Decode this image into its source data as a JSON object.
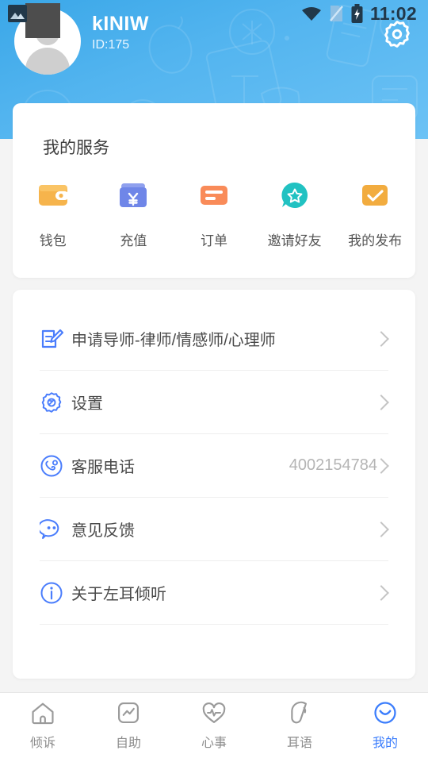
{
  "status_bar": {
    "time": "11:02",
    "icons": [
      "gallery-icon",
      "wifi-icon",
      "no-sim-icon",
      "battery-charging-icon"
    ]
  },
  "header": {
    "username": "kINIW",
    "user_id": "ID:175",
    "avatar_icon": "default-avatar-icon",
    "settings_icon": "gear-icon",
    "bg_color": "#52b4ef"
  },
  "service_card": {
    "title": "我的服务",
    "items": [
      {
        "label": "钱包",
        "icon": "wallet-icon",
        "color": "#f6b44c"
      },
      {
        "label": "充值",
        "icon": "recharge-card-icon",
        "color": "#6f86e8"
      },
      {
        "label": "订单",
        "icon": "order-list-icon",
        "color": "#f98b59"
      },
      {
        "label": "邀请好友",
        "icon": "invite-star-icon",
        "color": "#21c2c2"
      },
      {
        "label": "我的发布",
        "icon": "check-square-icon",
        "color": "#f2ac3f"
      }
    ]
  },
  "menu_card": {
    "rows": [
      {
        "label": "申请导师-律师/情感师/心理师",
        "icon": "apply-edit-icon",
        "value": ""
      },
      {
        "label": "设置",
        "icon": "settings-gear-icon",
        "value": ""
      },
      {
        "label": "客服电话",
        "icon": "phone-support-icon",
        "value": "4002154784"
      },
      {
        "label": "意见反馈",
        "icon": "feedback-chat-icon",
        "value": ""
      },
      {
        "label": "关于左耳倾听",
        "icon": "info-circle-icon",
        "value": ""
      }
    ],
    "chevron_icon": "chevron-right-icon",
    "accent_color": "#4a7dfc"
  },
  "tabbar": {
    "active_color": "#3b7dfc",
    "inactive_color": "#8d8d8d",
    "tabs": [
      {
        "label": "倾诉",
        "icon": "home-icon",
        "active": false
      },
      {
        "label": "自助",
        "icon": "chart-box-icon",
        "active": false
      },
      {
        "label": "心事",
        "icon": "heart-pulse-icon",
        "active": false
      },
      {
        "label": "耳语",
        "icon": "ear-icon",
        "active": false
      },
      {
        "label": "我的",
        "icon": "smiley-icon",
        "active": true
      }
    ]
  }
}
